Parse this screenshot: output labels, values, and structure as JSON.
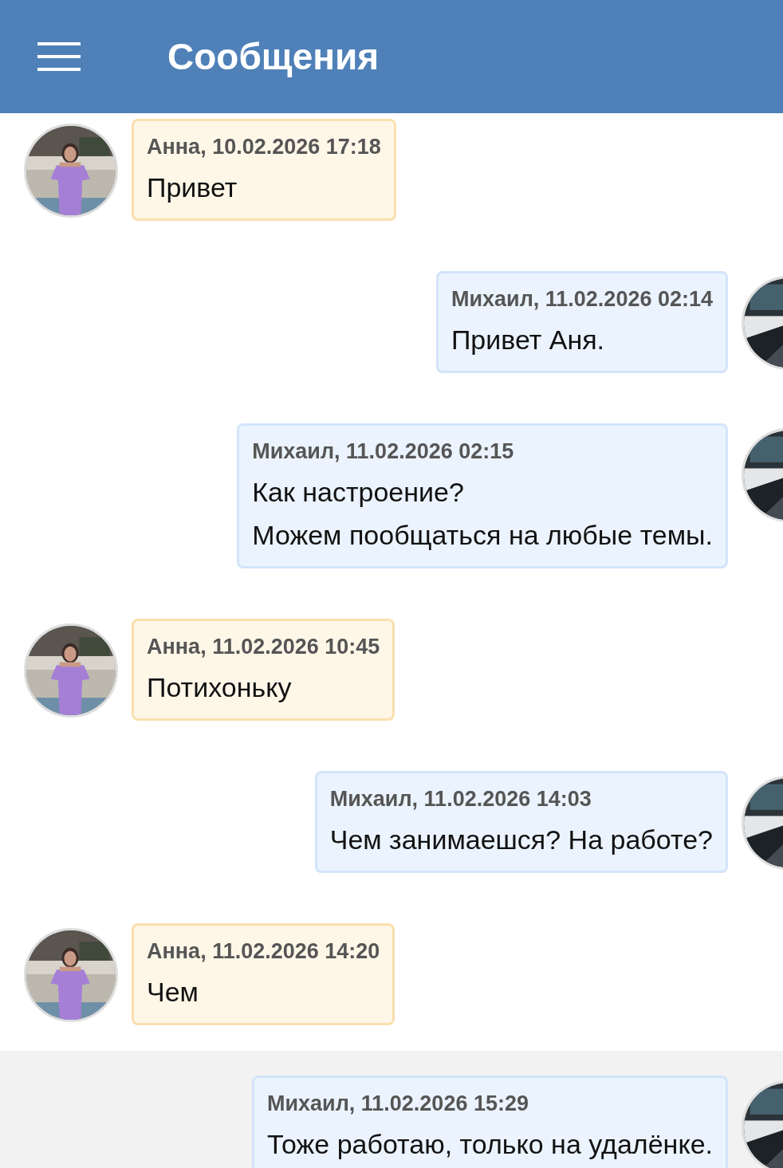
{
  "header": {
    "title": "Сообщения"
  },
  "messages": [
    {
      "kind": "incoming",
      "meta": "Анна, 10.02.2026 17:18",
      "text": "Привет",
      "highlighted": false
    },
    {
      "kind": "outgoing",
      "meta": "Михаил, 11.02.2026 02:14",
      "text": "Привет Аня.",
      "highlighted": false
    },
    {
      "kind": "outgoing",
      "meta": "Михаил, 11.02.2026 02:15",
      "text": "Как настроение?\nМожем пообщаться на любые темы.",
      "highlighted": false
    },
    {
      "kind": "incoming",
      "meta": "Анна, 11.02.2026 10:45",
      "text": "Потихоньку",
      "highlighted": false
    },
    {
      "kind": "outgoing",
      "meta": "Михаил, 11.02.2026 14:03",
      "text": "Чем занимаешся? На работе?",
      "highlighted": false
    },
    {
      "kind": "incoming",
      "meta": "Анна, 11.02.2026 14:20",
      "text": "Чем",
      "highlighted": false
    },
    {
      "kind": "outgoing",
      "meta": "Михаил, 11.02.2026 15:29",
      "text": "Тоже работаю, только на удалёнке.",
      "highlighted": true
    }
  ]
}
